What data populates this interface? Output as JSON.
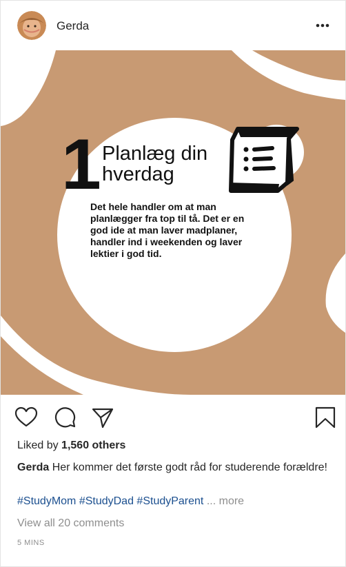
{
  "post": {
    "username": "Gerda",
    "more_icon": "more-horizontal-icon",
    "image": {
      "number": "1",
      "heading": "Planlæg din hverdag",
      "text": "Det hele handler om at man planlægger fra top til tå. Det er en god ide at man laver madplaner, handler ind i weekenden og laver lektier i god tid.",
      "icon": "checklist-icon",
      "colors": {
        "background": "#c89a73",
        "blob": "#ffffff",
        "text": "#111111"
      }
    },
    "actions": {
      "like_icon": "heart-icon",
      "comment_icon": "comment-icon",
      "share_icon": "send-icon",
      "save_icon": "bookmark-icon"
    },
    "likes": {
      "prefix": "Liked by",
      "count": "1,560 others"
    },
    "caption": {
      "username": "Gerda",
      "text": "Her kommer det første godt råd for studerende forældre!"
    },
    "hashtags": "#StudyMom #StudyDad #StudyParent",
    "more_label": "... more",
    "view_comments": "View all 20 comments",
    "timestamp": "5 MINS"
  }
}
